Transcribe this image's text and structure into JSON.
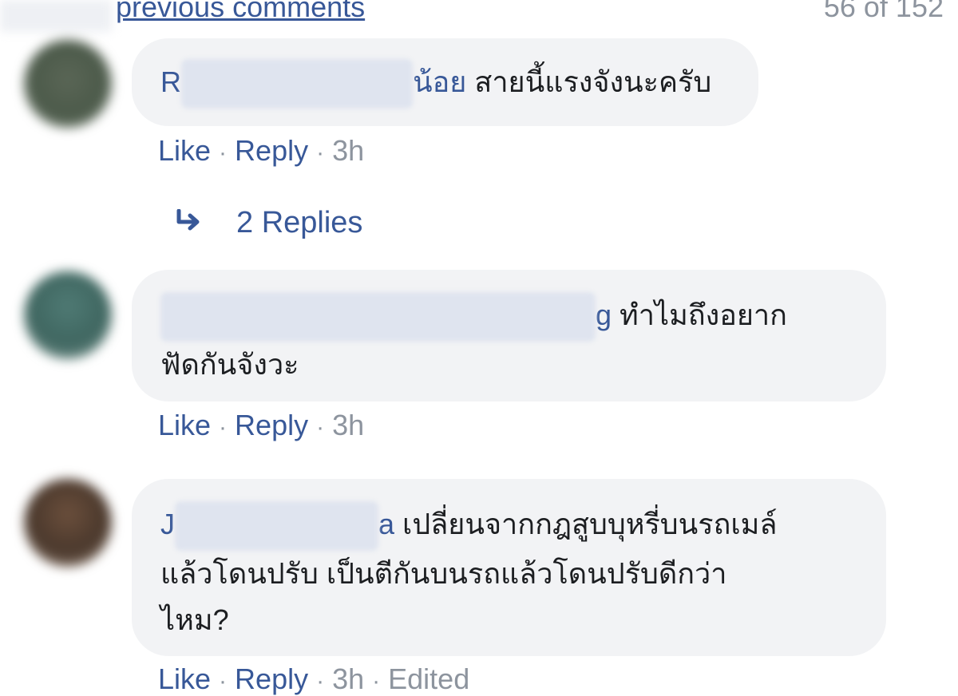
{
  "header": {
    "previous_comments_label": "previous comments",
    "comment_count": "56 of 152"
  },
  "comments": [
    {
      "name_visible": "น้อย",
      "text": "สายนี้แรงจังนะครับ",
      "actions": {
        "like": "Like",
        "reply": "Reply",
        "time": "3h"
      },
      "replies": "2 Replies"
    },
    {
      "name_visible": "g",
      "text_line1": "ทำไมถึงอยาก",
      "text_line2": "ฟัดกันจังวะ",
      "actions": {
        "like": "Like",
        "reply": "Reply",
        "time": "3h"
      }
    },
    {
      "name_visible": "a",
      "text_line1": "เปลี่ยนจากกฎสูบบุหรี่บนรถเมล์",
      "text_line2": "แล้วโดนปรับ เป็นตีกันบนรถแล้วโดนปรับดีกว่า",
      "text_line3": "ไหม?",
      "actions": {
        "like": "Like",
        "reply": "Reply",
        "time": "3h",
        "edited": "Edited"
      }
    }
  ],
  "colors": {
    "link": "#385898",
    "meta": "#8d949e",
    "bubble": "#f2f3f5",
    "text": "#1c1e21"
  },
  "icons": {
    "replies_arrow": "reply-arrow-icon"
  }
}
